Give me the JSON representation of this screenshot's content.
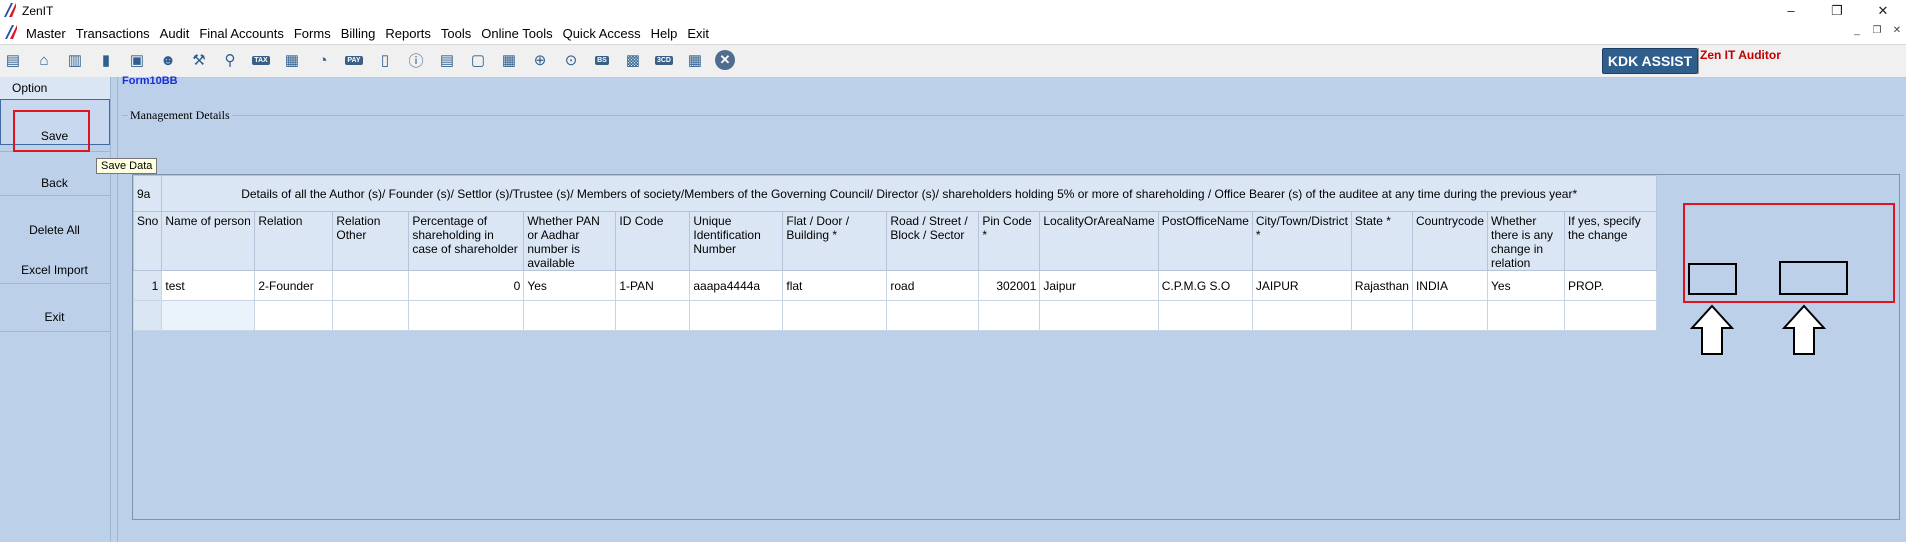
{
  "app": {
    "title": "ZenIT"
  },
  "window_controls": {
    "minimize": "–",
    "maximize": "❐",
    "close": "✕"
  },
  "menu": {
    "items": [
      "Master",
      "Transactions",
      "Audit",
      "Final Accounts",
      "Forms",
      "Billing",
      "Reports",
      "Tools",
      "Online Tools",
      "Quick Access",
      "Help",
      "Exit"
    ]
  },
  "toolbar": {
    "icons": [
      {
        "name": "report-icon",
        "glyph": "▤"
      },
      {
        "name": "home-icon",
        "glyph": "⌂"
      },
      {
        "name": "building-icon",
        "glyph": "▥"
      },
      {
        "name": "bar-chart-icon",
        "glyph": "▮"
      },
      {
        "name": "gift-icon",
        "glyph": "▣"
      },
      {
        "name": "users-icon",
        "glyph": "☻"
      },
      {
        "name": "hammer-icon",
        "glyph": "⚒"
      },
      {
        "name": "filter-icon",
        "glyph": "⚲"
      },
      {
        "name": "tax-icon",
        "glyph": "TAX",
        "mini": true
      },
      {
        "name": "calculator-icon",
        "glyph": "▦"
      },
      {
        "name": "pie-chart-icon",
        "glyph": "◔"
      },
      {
        "name": "pay-icon",
        "glyph": "PAY",
        "mini": true
      },
      {
        "name": "book-icon",
        "glyph": "▯"
      },
      {
        "name": "info-icon",
        "glyph": "ⓘ"
      },
      {
        "name": "ledger-icon",
        "glyph": "▤"
      },
      {
        "name": "document-user-icon",
        "glyph": "▢"
      },
      {
        "name": "calendar-icon",
        "glyph": "▦"
      },
      {
        "name": "add-icon",
        "glyph": "⊕"
      },
      {
        "name": "search-icon",
        "glyph": "⊙"
      },
      {
        "name": "balance-sheet-icon",
        "glyph": "BS",
        "mini": true
      },
      {
        "name": "database-icon",
        "glyph": "▩"
      },
      {
        "name": "form-3cd-icon",
        "glyph": "3CD",
        "mini": true
      },
      {
        "name": "grid-icon",
        "glyph": "▦"
      },
      {
        "name": "close-icon",
        "glyph": "✕",
        "close": true
      }
    ],
    "kdk_assist": "KDK ASSIST",
    "product": "Zen IT Auditor"
  },
  "left_panel": {
    "header": "Option",
    "buttons": [
      "Save",
      "Back",
      "Delete All",
      "Excel Import",
      "Exit"
    ],
    "tooltip": "Save Data"
  },
  "form": {
    "tag": "Form10BB",
    "section": "Management Details"
  },
  "grid": {
    "group_code": "9a",
    "group_title": "Details of all the Author (s)/ Founder (s)/ Settlor (s)/Trustee (s)/ Members of society/Members of the Governing Council/ Director (s)/ shareholders holding 5% or more of shareholding / Office Bearer (s) of the auditee at any time during the previous year*",
    "columns": [
      "Sno",
      "Name of person",
      "Relation",
      "Relation Other",
      "Percentage of shareholding in case of shareholder",
      "Whether PAN or Aadhar number is available",
      "ID Code",
      "Unique Identification Number",
      "Flat / Door / Building *",
      "Road / Street / Block / Sector",
      "Pin Code *",
      "LocalityOrAreaName",
      "PostOfficeName",
      "City/Town/District *",
      "State *",
      "Countrycode",
      "Whether there is any change in relation",
      "If yes, specify the change"
    ],
    "rows": [
      [
        "1",
        "test",
        "2-Founder",
        "",
        "0",
        "Yes",
        "1-PAN",
        "aaapa4444a",
        "flat",
        "road",
        "302001",
        "Jaipur",
        "C.P.M.G S.O",
        "JAIPUR",
        "Rajasthan",
        "INDIA",
        "Yes",
        "PROP."
      ]
    ]
  }
}
